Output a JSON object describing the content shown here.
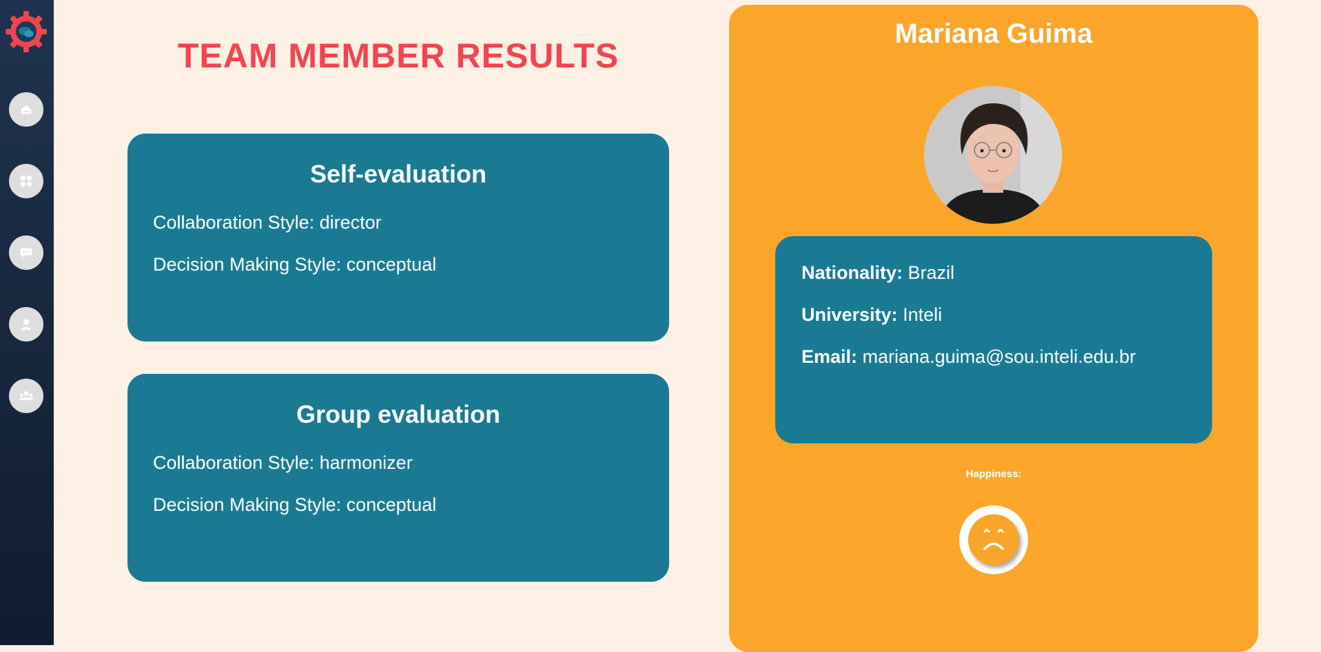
{
  "page": {
    "title": "TEAM MEMBER RESULTS"
  },
  "sidebar": {
    "logo_icon": "gear-chat-logo-icon",
    "items": [
      {
        "icon": "home-icon"
      },
      {
        "icon": "grid-icon"
      },
      {
        "icon": "chat-icon"
      },
      {
        "icon": "user-icon"
      },
      {
        "icon": "team-icon"
      }
    ]
  },
  "self_evaluation": {
    "title": "Self-evaluation",
    "collaboration": "Collaboration Style: director",
    "decision": "Decision Making Style: conceptual"
  },
  "group_evaluation": {
    "title": "Group evaluation",
    "collaboration": "Collaboration Style: harmonizer",
    "decision": "Decision Making Style: conceptual"
  },
  "profile": {
    "name": "Mariana Guima",
    "nationality_label": "Nationality:",
    "nationality": "Brazil",
    "university_label": "University:",
    "university": "Inteli",
    "email_label": "Email:",
    "email": "mariana.guima@sou.inteli.edu.br",
    "happiness_label": "Happiness:",
    "mood_icon": "sad-face-icon"
  },
  "colors": {
    "background": "#fdf0e4",
    "title_red": "#f24452",
    "card_teal": "#1a7a93",
    "profile_orange": "#fba62a",
    "sidebar_navy": "#17283f"
  }
}
